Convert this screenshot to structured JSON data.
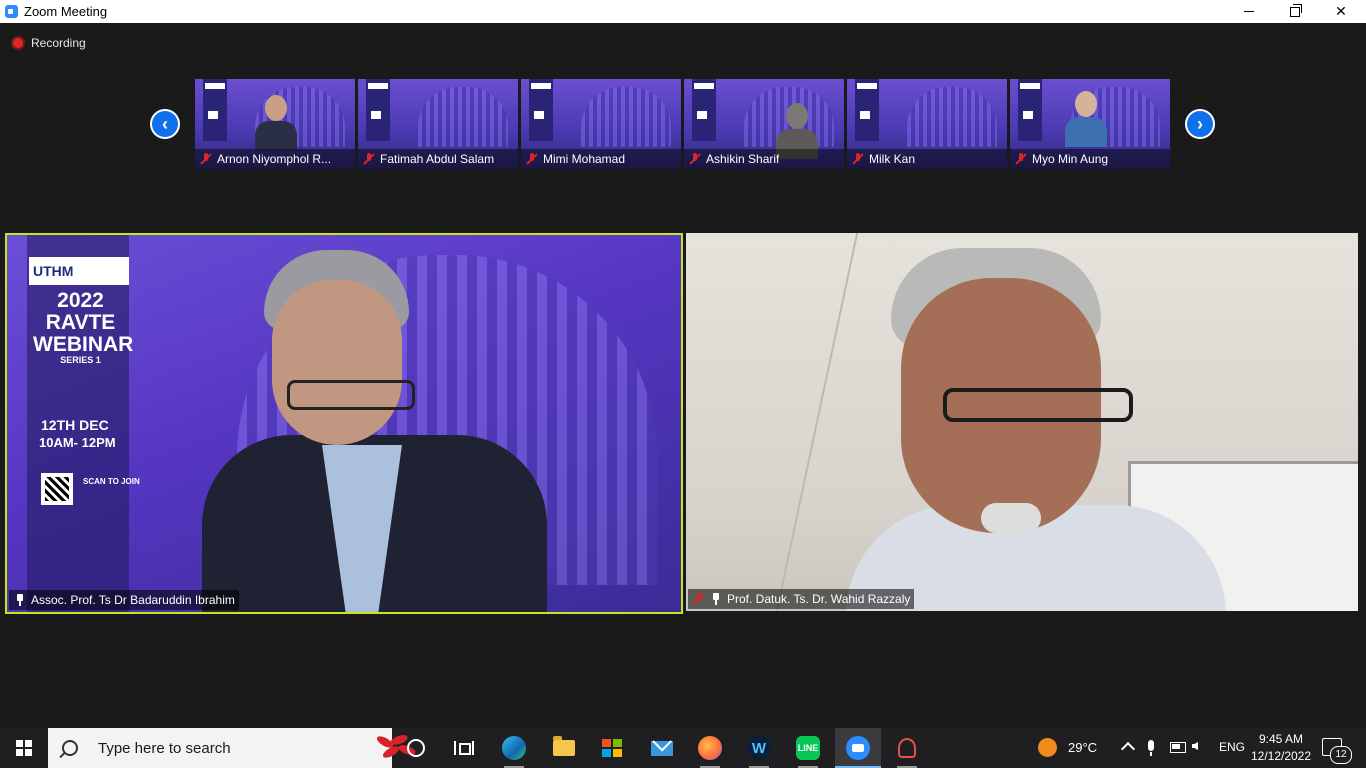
{
  "window": {
    "title": "Zoom Meeting"
  },
  "recording": {
    "label": "Recording"
  },
  "strip": {
    "participants": [
      {
        "name": "Arnon Niyomphol R...",
        "muted": true
      },
      {
        "name": "Fatimah Abdul Salam",
        "muted": true
      },
      {
        "name": "Mimi Mohamad",
        "muted": true
      },
      {
        "name": "Ashikin Sharif",
        "muted": true
      },
      {
        "name": "Milk Kan",
        "muted": true
      },
      {
        "name": "Myo Min Aung",
        "muted": true
      }
    ]
  },
  "main": {
    "left": {
      "name": "Assoc. Prof. Ts Dr Badaruddin Ibrahim",
      "poster": {
        "org": "UTHM",
        "year": "2022",
        "title_line1": "RAVTE",
        "title_line2": "WEBINAR",
        "series": "SERIES 1",
        "date": "12TH DEC",
        "time": "10AM- 12PM",
        "scan": "SCAN TO JOIN"
      },
      "active_speaker_color": "#c7e51f"
    },
    "right": {
      "name": "Prof. Datuk. Ts. Dr. Wahid Razzaly",
      "muted": true
    }
  },
  "taskbar": {
    "search_placeholder": "Type here to search",
    "weather": "29°C",
    "language": "ENG",
    "time": "9:45 AM",
    "date": "12/12/2022",
    "notifications": "12",
    "apps": [
      "cortana-icon",
      "task-view-icon",
      "edge-icon",
      "file-explorer-icon",
      "store-icon",
      "mail-icon",
      "firefox-icon",
      "webex-icon",
      "line-icon",
      "zoom-icon",
      "snip-icon"
    ]
  },
  "colors": {
    "accent": "#0e71eb",
    "muted": "#e02424",
    "zoom": "#2d8cff"
  }
}
